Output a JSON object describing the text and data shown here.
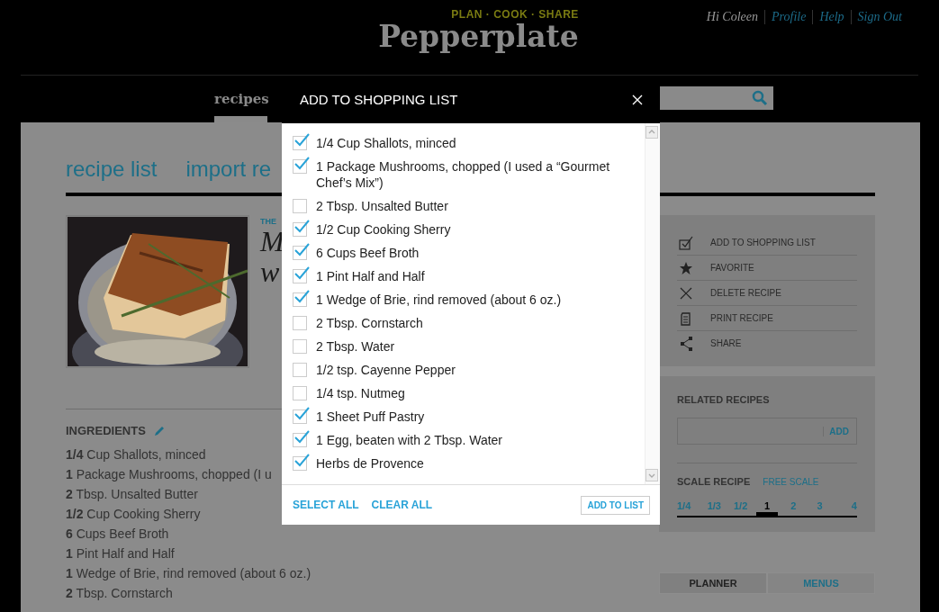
{
  "header": {
    "tagline": "PLAN · COOK · SHARE",
    "logo": "Pepperplate",
    "greeting": "Hi Coleen",
    "links": [
      "Profile",
      "Help",
      "Sign Out"
    ]
  },
  "nav": {
    "tabs": [
      {
        "label": "recipes",
        "selected": true
      }
    ]
  },
  "recipe_tabs": [
    "recipe list",
    "import re"
  ],
  "recipe": {
    "source": "THE",
    "title_lines": [
      "M",
      "w"
    ]
  },
  "ingredients": {
    "heading": "INGREDIENTS",
    "items": [
      "**1/4** Cup Shallots, minced",
      "**1** Package Mushrooms, chopped (I u",
      "**2** Tbsp. Unsalted Butter",
      "**1/2** Cup Cooking Sherry",
      "**6** Cups Beef Broth",
      "**1** Pint Half and Half",
      "**1** Wedge of Brie, rind removed (about 6 oz.)",
      "**2** Tbsp. Cornstarch"
    ]
  },
  "actions": [
    {
      "label": "ADD TO SHOPPING LIST",
      "kind": "list"
    },
    {
      "label": "FAVORITE",
      "kind": "star"
    },
    {
      "label": "DELETE RECIPE",
      "kind": "delete"
    },
    {
      "label": "PRINT RECIPE",
      "kind": "print"
    },
    {
      "label": "SHARE",
      "kind": "share"
    }
  ],
  "related": {
    "heading": "RELATED RECIPES",
    "button": "ADD"
  },
  "scale": {
    "heading": "SCALE RECIPE",
    "free": "FREE SCALE",
    "options": [
      {
        "label": "1/4",
        "selected": false
      },
      {
        "label": "1/3",
        "selected": false
      },
      {
        "label": "1/2",
        "selected": false
      },
      {
        "label": "1",
        "selected": true
      },
      {
        "label": "2",
        "selected": false
      },
      {
        "label": "3",
        "selected": false
      },
      {
        "label": "4",
        "selected": false
      }
    ]
  },
  "side_tabs": [
    {
      "label": "PLANNER",
      "selected": true
    },
    {
      "label": "MENUS",
      "selected": false
    }
  ],
  "dialog": {
    "title": "ADD TO SHOPPING LIST",
    "items": [
      {
        "label": "1/4 Cup Shallots, minced",
        "checked": true
      },
      {
        "label": "1 Package Mushrooms, chopped (I used a “Gourmet Chef’s Mix”)",
        "checked": true
      },
      {
        "label": "2 Tbsp. Unsalted Butter",
        "checked": false
      },
      {
        "label": "1/2 Cup Cooking Sherry",
        "checked": true
      },
      {
        "label": "6 Cups Beef Broth",
        "checked": true
      },
      {
        "label": "1 Pint Half and Half",
        "checked": true
      },
      {
        "label": "1 Wedge of Brie, rind removed (about 6 oz.)",
        "checked": true
      },
      {
        "label": "2 Tbsp. Cornstarch",
        "checked": false
      },
      {
        "label": "2 Tbsp. Water",
        "checked": false
      },
      {
        "label": "1/2 tsp. Cayenne Pepper",
        "checked": false
      },
      {
        "label": "1/4 tsp. Nutmeg",
        "checked": false
      },
      {
        "label": "1 Sheet Puff Pastry",
        "checked": true
      },
      {
        "label": "1 Egg, beaten with 2 Tbsp. Water",
        "checked": true
      },
      {
        "label": "Herbs de Provence",
        "checked": true
      }
    ],
    "select_all": "SELECT ALL",
    "clear_all": "CLEAR ALL",
    "submit": "ADD TO LIST"
  }
}
